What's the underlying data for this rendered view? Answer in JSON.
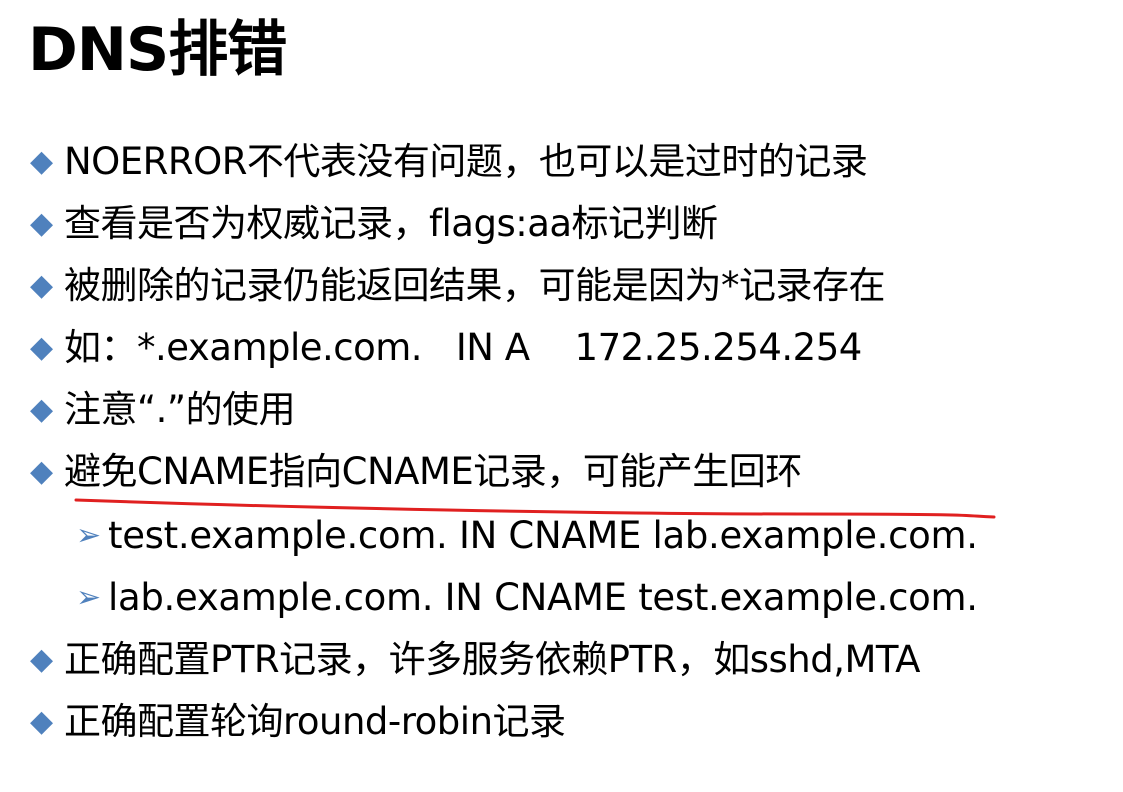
{
  "title": "DNS排错",
  "items": [
    {
      "level": 1,
      "text": "NOERROR不代表没有问题，也可以是过时的记录"
    },
    {
      "level": 1,
      "text": "查看是否为权威记录，flags:aa标记判断"
    },
    {
      "level": 1,
      "text": "被删除的记录仍能返回结果，可能是因为*记录存在"
    },
    {
      "level": 1,
      "text": "如：*.example.com.   IN A    172.25.254.254"
    },
    {
      "level": 1,
      "text": "注意“.”的使用"
    },
    {
      "level": 1,
      "text": "避免CNAME指向CNAME记录，可能产生回环"
    },
    {
      "level": 2,
      "text": "test.example.com. IN CNAME lab.example.com."
    },
    {
      "level": 2,
      "text": "lab.example.com. IN CNAME test.example.com."
    },
    {
      "level": 1,
      "text": "正确配置PTR记录，许多服务依赖PTR，如sshd,MTA"
    },
    {
      "level": 1,
      "text": "正确配置轮询round-robin记录"
    }
  ],
  "markers": {
    "level1": "◆",
    "level2": "➢"
  },
  "colors": {
    "bullet": "#4f81bd",
    "text": "#000000",
    "annotation": "#e02020"
  }
}
